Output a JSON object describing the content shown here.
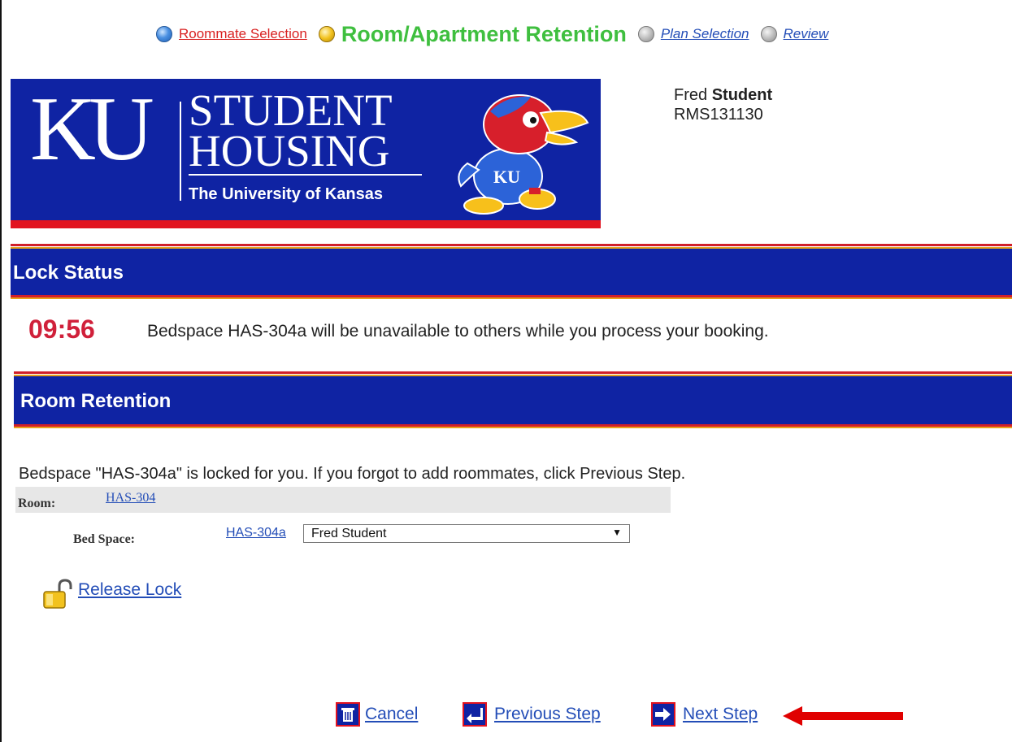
{
  "steps": [
    {
      "label": "Roommate Selection",
      "state": "done",
      "dot": "blue-dot-icon"
    },
    {
      "label": "Room/Apartment Retention",
      "state": "current",
      "dot": "yellow-dot-icon"
    },
    {
      "label": "Plan Selection",
      "state": "upcoming",
      "dot": "gray-dot-icon"
    },
    {
      "label": "Review",
      "state": "upcoming",
      "dot": "gray-dot-icon"
    }
  ],
  "banner": {
    "logo_letters": "KU",
    "line1": "STUDENT",
    "line2": "HOUSING",
    "university": "The University of Kansas"
  },
  "user": {
    "first_name": "Fred",
    "last_name": "Student",
    "id": "RMS131130"
  },
  "lock_status": {
    "heading": "Lock Status",
    "timer": "09:56",
    "message": "Bedspace HAS-304a will be unavailable to others while you process your booking."
  },
  "room_retention": {
    "heading": "Room Retention",
    "instruction": "Bedspace \"HAS-304a\" is locked for you. If you forgot to add roommates, click Previous Step.",
    "room_label": "Room:",
    "room_value": "HAS-304",
    "bed_label": "Bed Space:",
    "bed_value": "HAS-304a",
    "occupant_selected": "Fred Student",
    "release_lock": "Release Lock"
  },
  "actions": {
    "cancel": "Cancel",
    "previous": "Previous Step",
    "next": "Next Step"
  },
  "colors": {
    "banner_blue": "#0f23a3",
    "accent_red": "#e2131f",
    "accent_gold": "#e9a21b",
    "link_blue": "#234db7",
    "timer_red": "#d0203a",
    "current_step_green": "#3fbf3f"
  }
}
